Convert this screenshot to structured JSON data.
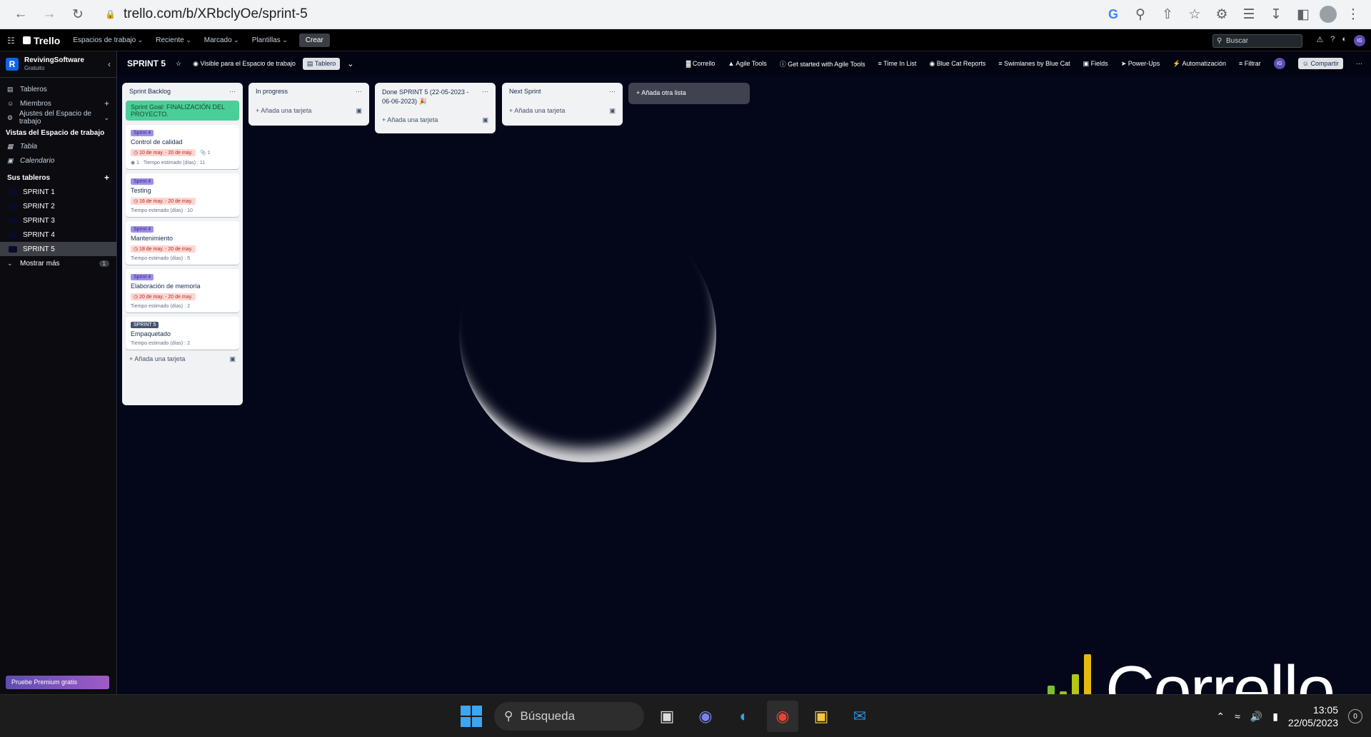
{
  "browser": {
    "url": "trello.com/b/XRbclyOe/sprint-5"
  },
  "header": {
    "logo": "Trello",
    "menu": [
      "Espacios de trabajo",
      "Reciente",
      "Marcado",
      "Plantillas"
    ],
    "create": "Crear",
    "search_placeholder": "Buscar",
    "avatar": "IG"
  },
  "sidebar": {
    "workspace_name": "RevivingSoftware",
    "workspace_plan": "Gratuito",
    "workspace_initial": "R",
    "items": [
      "Tableros",
      "Miembros",
      "Ajustes del Espacio de trabajo"
    ],
    "views_heading": "Vistas del Espacio de trabajo",
    "views": [
      "Tabla",
      "Calendario"
    ],
    "boards_heading": "Sus tableros",
    "boards": [
      "SPRINT 1",
      "SPRINT 2",
      "SPRINT 3",
      "SPRINT 4",
      "SPRINT 5"
    ],
    "show_more": "Mostrar más",
    "show_more_count": "1",
    "premium": "Pruebe Premium gratis"
  },
  "board": {
    "title": "SPRINT 5",
    "visibility": "Visible para el Espacio de trabajo",
    "view": "Tablero",
    "tools": [
      "Corrello",
      "Agile Tools",
      "Get started with Agile Tools",
      "Time In List",
      "Blue Cat Reports",
      "Swimlanes by Blue Cat",
      "Fields",
      "Power-Ups",
      "Automatización",
      "Filtrar"
    ],
    "share": "Compartir",
    "add_list": "Añada otra lista",
    "add_card": "Añada una tarjeta"
  },
  "lists": [
    {
      "title": "Sprint Backlog",
      "goal": "Sprint Goal: FINALIZACIÓN DEL PROYECTO.",
      "cards": [
        {
          "label": "Sprint 4",
          "title": "Control de calidad",
          "date": "10 de may. - 20 de may.",
          "attachments": "1",
          "github": "1",
          "meta": "Tiempo estimado (días) : 11"
        },
        {
          "label": "Sprint 4",
          "title": "Testing",
          "date": "16 de may. - 20 de may.",
          "meta": "Tiempo estimado (días) : 10"
        },
        {
          "label": "Sprint 4",
          "title": "Mantenimiento",
          "date": "18 de may. - 20 de may.",
          "meta": "Tiempo estimado (días) : 5"
        },
        {
          "label": "Sprint 4",
          "title": "Elaboración de memoria",
          "date": "20 de may. - 20 de may.",
          "meta": "Tiempo estimado (días) : 2"
        },
        {
          "label": "SPRINT 5",
          "title": "Empaquetado",
          "meta": "Tiempo estimado (días) : 2"
        }
      ]
    },
    {
      "title": "In progress"
    },
    {
      "title": "Done SPRINT 5 (22-05-2023 - 06-06-2023)"
    },
    {
      "title": "Next Sprint"
    }
  ],
  "overlay": {
    "brand": "Corrello"
  },
  "taskbar": {
    "search": "Búsqueda",
    "time": "13:05",
    "date": "22/05/2023",
    "notifications": "0"
  },
  "colors": {
    "board_bg": "#04071a",
    "goal": "#4bce97",
    "label": "#9f8fef",
    "date_bg": "#ffd5d2",
    "premium": "#5e4db2"
  }
}
